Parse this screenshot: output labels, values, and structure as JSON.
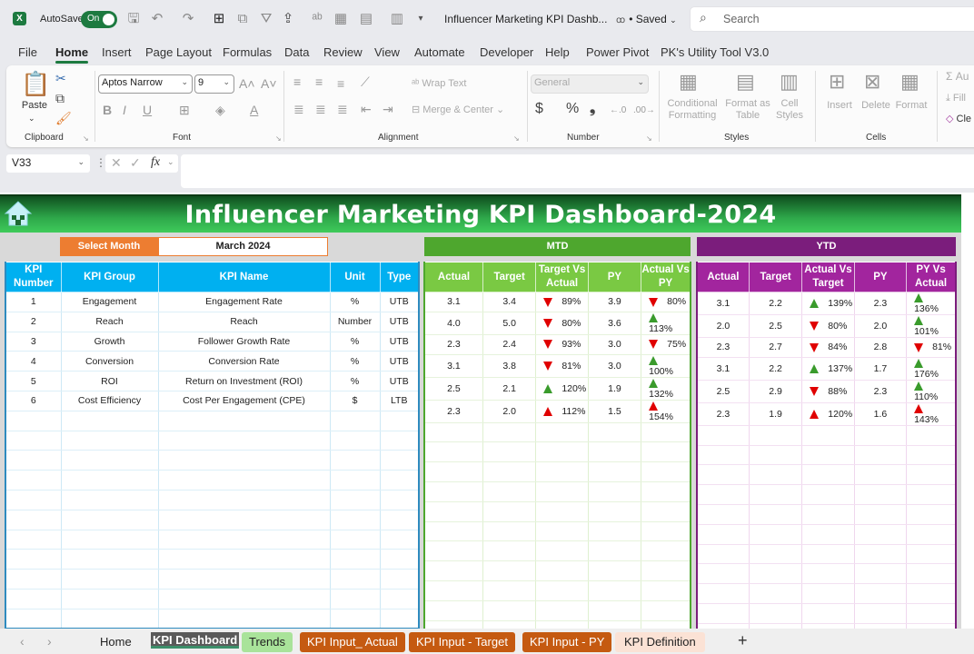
{
  "titlebar": {
    "autosave_label": "AutoSave",
    "autosave_state": "On",
    "doc_title": "Influencer Marketing KPI Dashb...",
    "saved_status": "• Saved",
    "search_placeholder": "Search"
  },
  "menu_tabs": [
    "File",
    "Home",
    "Insert",
    "Page Layout",
    "Formulas",
    "Data",
    "Review",
    "View",
    "Automate",
    "Developer",
    "Help",
    "Power Pivot",
    "PK's Utility Tool V3.0"
  ],
  "active_menu_tab": "Home",
  "ribbon": {
    "paste_label": "Paste",
    "clipboard_label": "Clipboard",
    "font_name": "Aptos Narrow",
    "font_size": "9",
    "font_label": "Font",
    "wrap_text": "Wrap Text",
    "merge_center": "Merge & Center",
    "alignment_label": "Alignment",
    "number_format": "General",
    "number_label": "Number",
    "conditional_formatting": "Conditional Formatting",
    "format_as_table": "Format as Table",
    "cell_styles": "Cell Styles",
    "styles_label": "Styles",
    "insert": "Insert",
    "delete": "Delete",
    "format": "Format",
    "cells_label": "Cells",
    "autosum": "Au",
    "fill": "Fill",
    "clear": "Cle"
  },
  "formula_bar": {
    "name_box": "V33",
    "formula": ""
  },
  "dashboard": {
    "title": "Influencer Marketing KPI Dashboard-2024",
    "select_month_label": "Select Month",
    "selected_month": "March 2024",
    "mtd_label": "MTD",
    "ytd_label": "YTD",
    "kpi_headers": [
      "KPI Number",
      "KPI Group",
      "KPI Name",
      "Unit",
      "Type"
    ],
    "mtd_headers": [
      "Actual",
      "Target",
      "Target Vs Actual",
      "PY",
      "Actual Vs PY"
    ],
    "ytd_headers": [
      "Actual",
      "Target",
      "Actual Vs Target",
      "PY",
      "PY Vs Actual"
    ],
    "kpis": [
      {
        "number": "1",
        "group": "Engagement",
        "name": "Engagement Rate",
        "unit": "%",
        "type": "UTB"
      },
      {
        "number": "2",
        "group": "Reach",
        "name": "Reach",
        "unit": "Number",
        "type": "UTB"
      },
      {
        "number": "3",
        "group": "Growth",
        "name": "Follower Growth Rate",
        "unit": "%",
        "type": "UTB"
      },
      {
        "number": "4",
        "group": "Conversion",
        "name": "Conversion Rate",
        "unit": "%",
        "type": "UTB"
      },
      {
        "number": "5",
        "group": "ROI",
        "name": "Return on Investment (ROI)",
        "unit": "%",
        "type": "UTB"
      },
      {
        "number": "6",
        "group": "Cost Efficiency",
        "name": "Cost Per Engagement (CPE)",
        "unit": "$",
        "type": "LTB"
      }
    ],
    "mtd": [
      {
        "actual": "3.1",
        "target": "3.4",
        "tva": "89%",
        "tva_icon": "down-red",
        "py": "3.9",
        "avp": "80%",
        "avp_icon": "down-red"
      },
      {
        "actual": "4.0",
        "target": "5.0",
        "tva": "80%",
        "tva_icon": "down-red",
        "py": "3.6",
        "avp": "113%",
        "avp_icon": "up-green"
      },
      {
        "actual": "2.3",
        "target": "2.4",
        "tva": "93%",
        "tva_icon": "down-red",
        "py": "3.0",
        "avp": "75%",
        "avp_icon": "down-red"
      },
      {
        "actual": "3.1",
        "target": "3.8",
        "tva": "81%",
        "tva_icon": "down-red",
        "py": "3.0",
        "avp": "100%",
        "avp_icon": "up-green"
      },
      {
        "actual": "2.5",
        "target": "2.1",
        "tva": "120%",
        "tva_icon": "up-green",
        "py": "1.9",
        "avp": "132%",
        "avp_icon": "up-green"
      },
      {
        "actual": "2.3",
        "target": "2.0",
        "tva": "112%",
        "tva_icon": "up-red",
        "py": "1.5",
        "avp": "154%",
        "avp_icon": "up-red"
      }
    ],
    "ytd": [
      {
        "actual": "3.1",
        "target": "2.2",
        "avt": "139%",
        "avt_icon": "up-green",
        "py": "2.3",
        "pva": "136%",
        "pva_icon": "up-green"
      },
      {
        "actual": "2.0",
        "target": "2.5",
        "avt": "80%",
        "avt_icon": "down-red",
        "py": "2.0",
        "pva": "101%",
        "pva_icon": "up-green"
      },
      {
        "actual": "2.3",
        "target": "2.7",
        "avt": "84%",
        "avt_icon": "down-red",
        "py": "2.8",
        "pva": "81%",
        "pva_icon": "down-red"
      },
      {
        "actual": "3.1",
        "target": "2.2",
        "avt": "137%",
        "avt_icon": "up-green",
        "py": "1.7",
        "pva": "176%",
        "pva_icon": "up-green"
      },
      {
        "actual": "2.5",
        "target": "2.9",
        "avt": "88%",
        "avt_icon": "down-red",
        "py": "2.3",
        "pva": "110%",
        "pva_icon": "up-green"
      },
      {
        "actual": "2.3",
        "target": "1.9",
        "avt": "120%",
        "avt_icon": "up-red",
        "py": "1.6",
        "pva": "143%",
        "pva_icon": "up-red"
      }
    ],
    "empty_rows": 11
  },
  "sheet_tabs": [
    {
      "label": "Home",
      "style": "plain"
    },
    {
      "label": "KPI Dashboard",
      "style": "active"
    },
    {
      "label": "Trends",
      "style": "green"
    },
    {
      "label": "KPI Input_ Actual",
      "style": "orange"
    },
    {
      "label": "KPI Input - Target",
      "style": "orange"
    },
    {
      "label": "KPI Input - PY",
      "style": "orange"
    },
    {
      "label": "KPI Definition",
      "style": "peach"
    }
  ],
  "colors": {
    "excel_green": "#1d7a40",
    "banner_green": "#2ea84a",
    "select_orange": "#ed7d31",
    "mtd_green": "#4ea72e",
    "mtd_header": "#7ac943",
    "ytd_purple": "#7b1d7c",
    "ytd_header": "#a2259e",
    "kpi_blue": "#00b0f0",
    "up_green": "#3a9b2c",
    "down_red": "#e00000"
  }
}
